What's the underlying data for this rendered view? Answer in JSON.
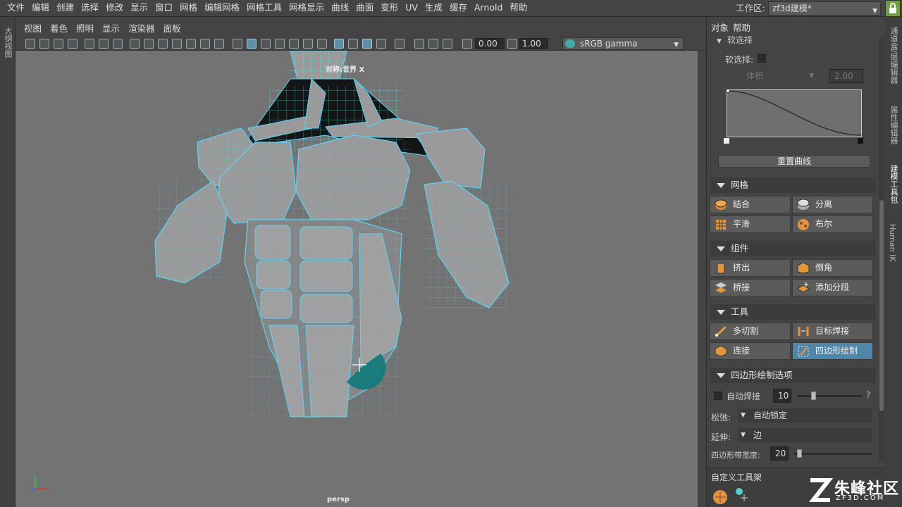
{
  "menubar": [
    "文件",
    "编辑",
    "创建",
    "选择",
    "修改",
    "显示",
    "窗口",
    "网格",
    "编辑网格",
    "网格工具",
    "网格显示",
    "曲线",
    "曲面",
    "变形",
    "UV",
    "生成",
    "缓存",
    "Arnold",
    "帮助"
  ],
  "workspace": {
    "label": "工作区:",
    "value": "zf3d建模*"
  },
  "left_strip": "大纲视图",
  "viewport_menu": [
    "视图",
    "着色",
    "照明",
    "显示",
    "渲染器",
    "面板"
  ],
  "toolbar": {
    "exposure": "0.00",
    "gamma": "1.00",
    "colorspace": "sRGB gamma"
  },
  "viewport": {
    "camera_label": "对称:世界 X",
    "view_name": "persp"
  },
  "panel": {
    "header": [
      "对象",
      "帮助"
    ],
    "soft_select": {
      "section": "软选择",
      "label": "软选择:",
      "falloff": "体积",
      "radius": "2.00",
      "reset": "重置曲线"
    },
    "mesh": {
      "title": "网格",
      "buttons": [
        "结合",
        "分离",
        "平滑",
        "布尔"
      ]
    },
    "components": {
      "title": "组件",
      "buttons": [
        "挤出",
        "倒角",
        "桥接",
        "添加分段"
      ]
    },
    "tools": {
      "title": "工具",
      "buttons": [
        "多切割",
        "目标焊接",
        "连接",
        "四边形绘制"
      ]
    },
    "quad_options": {
      "title": "四边形绘制选项",
      "autoweld_label": "自动焊接",
      "autoweld_value": "10",
      "help": "?",
      "relax_label": "松弛:",
      "relax_value": "自动锁定",
      "extend_label": "延伸:",
      "extend_value": "边",
      "strip_label": "四边形带宽度:",
      "strip_value": "20"
    },
    "custom_shelf": "自定义工具架"
  },
  "right_tabs": [
    "通道盒/层编辑器",
    "属性编辑器",
    "建模工具包",
    "Human IK"
  ],
  "watermark": {
    "brand": "朱峰社区",
    "url": "ZF3D.COM"
  },
  "colors": {
    "accent": "#5285a6",
    "wire": "#5fd3f5",
    "lock": "#6f9e45"
  }
}
